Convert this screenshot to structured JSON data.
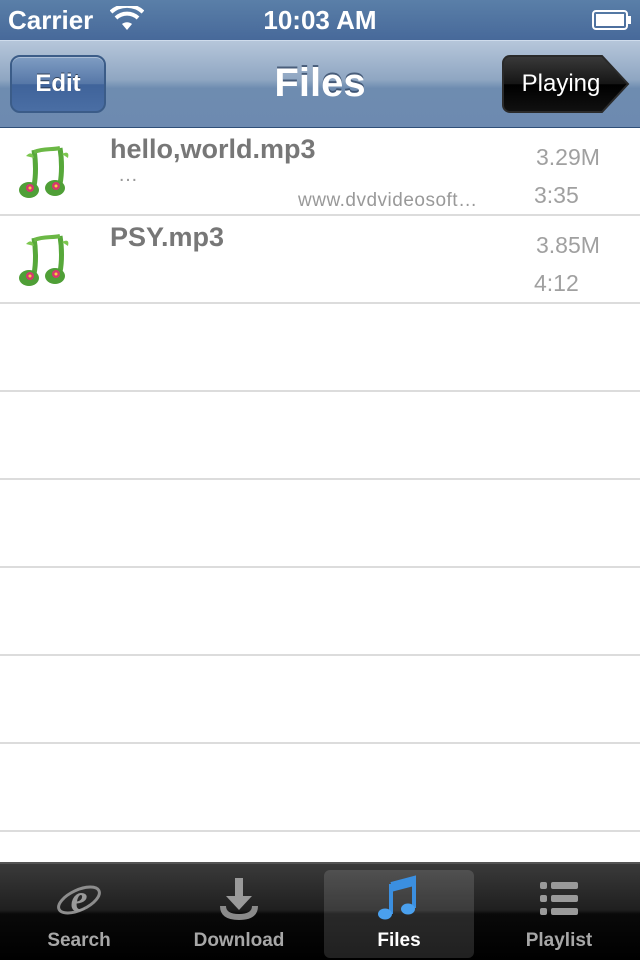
{
  "status_bar": {
    "carrier": "Carrier",
    "time": "10:03 AM"
  },
  "nav_bar": {
    "title": "Files",
    "edit_label": "Edit",
    "playing_label": "Playing"
  },
  "files": [
    {
      "title": "hello,world.mp3",
      "subtitle": "…",
      "source": "www.dvdvideosoft…",
      "size": "3.29M",
      "duration": "3:35",
      "icon": "music-notes-icon"
    },
    {
      "title": "PSY.mp3",
      "subtitle": "",
      "source": "",
      "size": "3.85M",
      "duration": "4:12",
      "icon": "music-notes-icon"
    }
  ],
  "tabs": [
    {
      "label": "Search",
      "icon": "internet-explorer-icon",
      "active": false
    },
    {
      "label": "Download",
      "icon": "download-icon",
      "active": false
    },
    {
      "label": "Files",
      "icon": "music-note-icon",
      "active": true
    },
    {
      "label": "Playlist",
      "icon": "list-icon",
      "active": false
    }
  ],
  "colors": {
    "nav_blue": "#6d8ab0",
    "active_tab_icon": "#3b8fe0"
  }
}
